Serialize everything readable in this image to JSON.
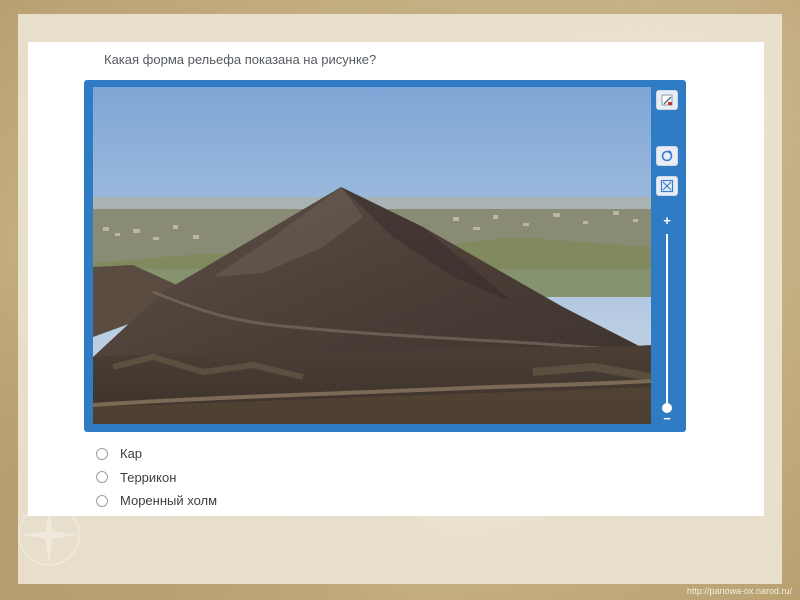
{
  "question": {
    "text": "Какая форма рельефа показана на рисунке?"
  },
  "viewer": {
    "image_description_icon": "photo-mountain",
    "tools": [
      {
        "name": "edit-icon"
      },
      {
        "name": "rotate-icon"
      },
      {
        "name": "fit-to-screen-icon"
      }
    ],
    "zoom": {
      "plus_label": "+",
      "minus_label": "−",
      "level_fraction": 0.0
    },
    "frame_color": "#2f7bc4"
  },
  "options": [
    {
      "label": "Кар",
      "selected": false
    },
    {
      "label": "Террикон",
      "selected": false
    },
    {
      "label": "Моренный холм",
      "selected": false
    }
  ],
  "footer": {
    "url": "http://panowa-ox.narod.ru/"
  }
}
